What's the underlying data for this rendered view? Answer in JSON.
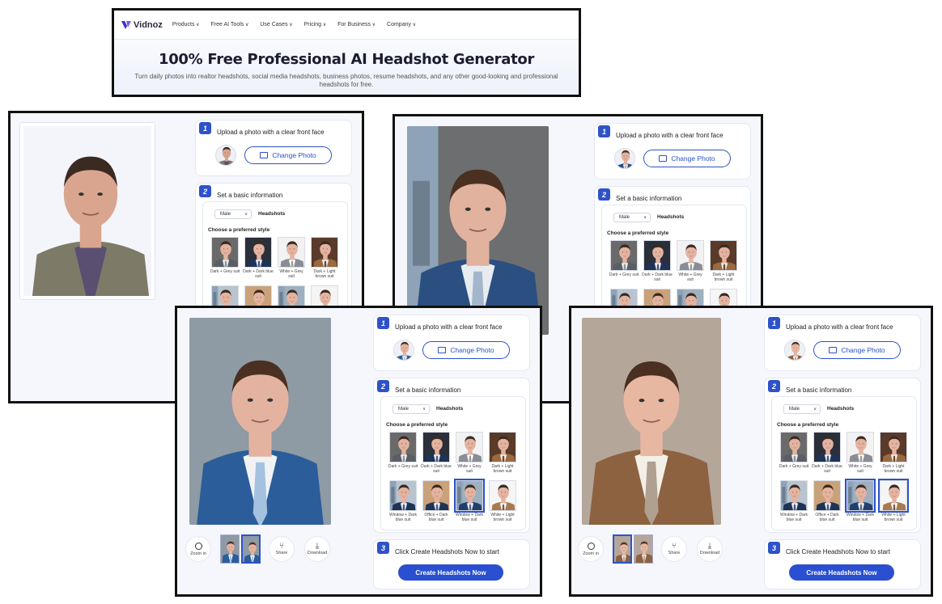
{
  "header": {
    "brand": "Vidnoz",
    "nav": [
      "Products",
      "Free AI Tools",
      "Use Cases",
      "Pricing",
      "For Business",
      "Company"
    ],
    "title": "100% Free Professional AI Headshot Generator",
    "subtitle": "Turn daily photos into realtor headshots, social media headshots, business photos, resume headshots, and any other good-looking and professional headshots for free."
  },
  "editor": {
    "step1_title": "Upload a photo with a clear front face",
    "change_photo": "Change Photo",
    "step2_title": "Set a basic information",
    "gender": "Male",
    "headshots_label": "Headshots",
    "style_label": "Choose a preferred style",
    "styles": [
      "Dark + Grey suit",
      "Dark + Dark blue suit",
      "White + Grey suit",
      "Dark + Light brown suit",
      "Window + Dark blue suit",
      "Office + Dark blue suit",
      "Window + Dark blue suit",
      "White + Light brown suit"
    ],
    "step3_title": "Click Create Headshots Now to start",
    "create_button": "Create Headshots Now",
    "zoom_in": "Zoom in",
    "share": "Share",
    "download": "Download"
  },
  "colors": {
    "accent": "#2e52c9",
    "border": "#111111"
  },
  "icons": [
    "vidnoz-logo-icon",
    "image-icon",
    "zoom-in-icon",
    "share-icon",
    "download-icon"
  ]
}
